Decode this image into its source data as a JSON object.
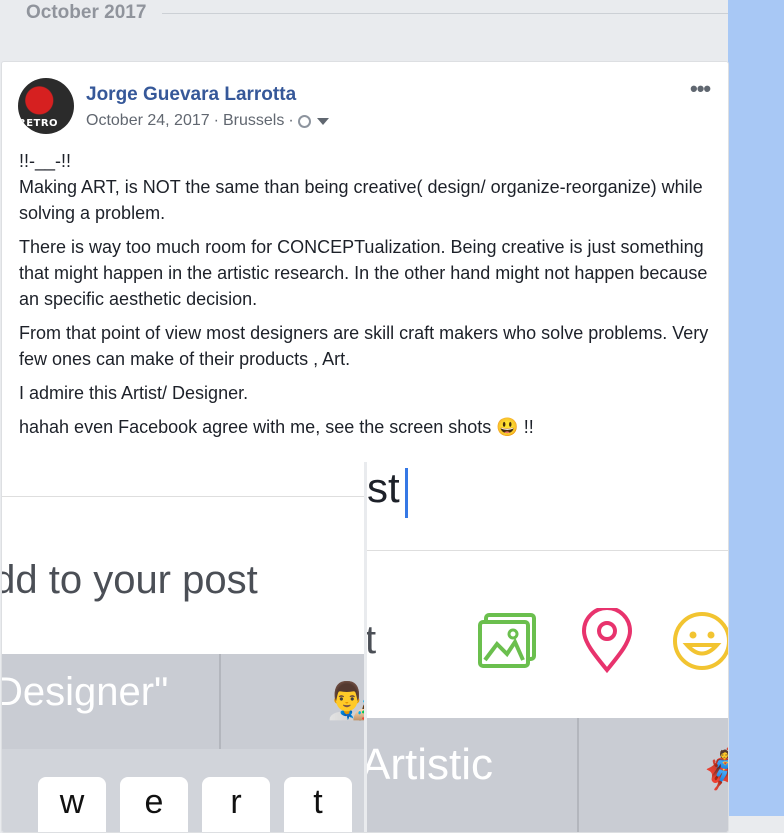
{
  "timeline": {
    "month_label": "October 2017"
  },
  "post": {
    "avatar_text": "RETRO",
    "author": "Jorge Guevara Larrotta",
    "date": "October 24, 2017",
    "location": "Brussels",
    "separator": "·",
    "privacy_icon": "globe-icon",
    "menu_label": "•••",
    "paragraphs": [
      "!!-__-!!\nMaking ART, is NOT the same than being creative( design/ organize-reorganize) while solving a problem.",
      "There is way too much room for CONCEPTualization. Being creative is just something that might happen in the artistic research. In the other hand might not happen because an specific aesthetic decision.",
      "From that point of view most designers are skill craft makers who solve problems. Very few ones can make of their products , Art.",
      "I admire this Artist/ Designer.",
      "hahah even Facebook agree with me, see the screen shots 😃 !!"
    ]
  },
  "screenshots": {
    "left": {
      "add_to_post": "\\dd to your post",
      "suggestion": "Designer\"",
      "suggestion_emoji": "👨‍🎨",
      "keys": [
        "w",
        "e",
        "r",
        "t"
      ]
    },
    "right": {
      "typed_text": "st",
      "fragment": "t",
      "suggestion": "Artistic",
      "suggestion_emoji": "🦸",
      "icons": [
        "photo-icon",
        "location-pin-icon",
        "smiley-icon"
      ],
      "colors": {
        "photo": "#6bbf4e",
        "pin": "#e8336d",
        "smile": "#f2c431"
      }
    }
  }
}
